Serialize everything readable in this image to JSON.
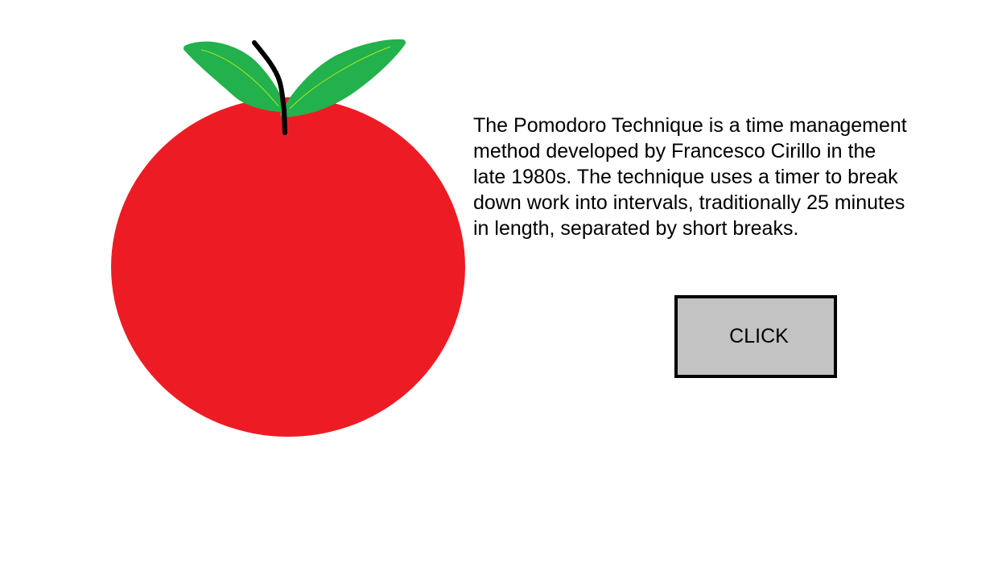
{
  "illustration": {
    "name": "tomato",
    "colors": {
      "fruit": "#ed1c24",
      "leaf": "#22b14c",
      "leaf_vein": "#b5e61d",
      "stem": "#000000"
    }
  },
  "description": {
    "text": "The Pomodoro Technique is a time management\nmethod developed by Francesco Cirillo in the\nlate 1980s. The technique uses a timer to break\ndown work into intervals, traditionally 25 minutes\nin length, separated by short breaks."
  },
  "button": {
    "label": "CLICK",
    "background": "#c3c3c3",
    "border": "#000000"
  }
}
